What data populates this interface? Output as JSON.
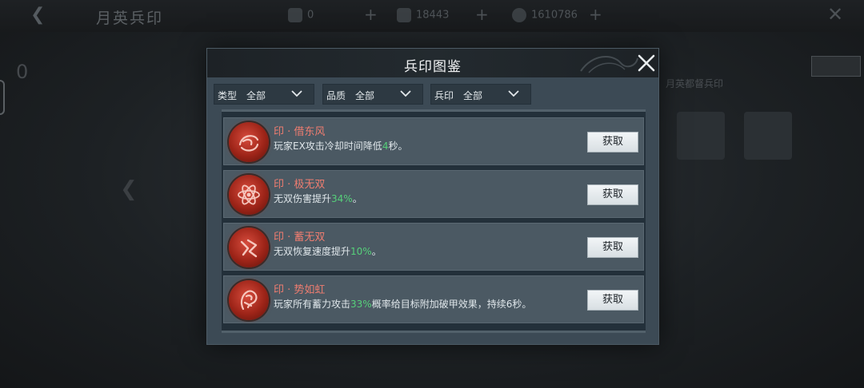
{
  "background": {
    "title": "月英兵印",
    "left_count": "0",
    "resources": [
      {
        "icon": "card-icon",
        "value": "0"
      },
      {
        "icon": "ore-icon",
        "value": "18443"
      },
      {
        "icon": "coin-icon",
        "value": "1610786"
      }
    ],
    "right_text": "月英都督兵印"
  },
  "modal": {
    "title": "兵印图鉴",
    "filters": [
      {
        "label": "类型",
        "value": "全部"
      },
      {
        "label": "品质",
        "value": "全部"
      },
      {
        "label": "兵印",
        "value": "全部"
      }
    ],
    "items": [
      {
        "name": "印 · 借东风",
        "desc_before": "玩家EX攻击冷却时间降低",
        "highlight": "4",
        "desc_after": "秒。",
        "button": "获取",
        "icon": "wind-seal-icon"
      },
      {
        "name": "印 · 极无双",
        "desc_before": "无双伤害提升",
        "highlight": "34%",
        "desc_after": "。",
        "button": "获取",
        "icon": "atom-seal-icon"
      },
      {
        "name": "印 · 蓄无双",
        "desc_before": "无双恢复速度提升",
        "highlight": "10%",
        "desc_after": "。",
        "button": "获取",
        "icon": "charge-seal-icon"
      },
      {
        "name": "印 · 势如虹",
        "desc_before": "玩家所有蓄力攻击",
        "highlight": "33%",
        "desc_after": "概率给目标附加破甲效果，持续6秒。",
        "button": "获取",
        "icon": "beast-seal-icon"
      }
    ]
  },
  "colors": {
    "name": "#ef7d70",
    "highlight": "#56d07a",
    "panel": "#3c4a55"
  }
}
